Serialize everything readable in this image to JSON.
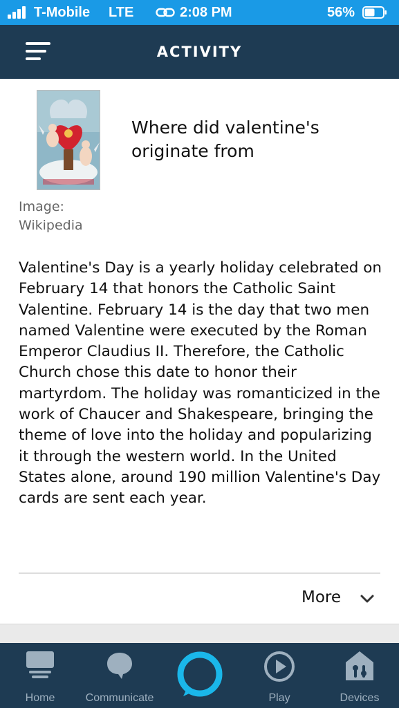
{
  "status_bar": {
    "carrier": "T-Mobile",
    "network": "LTE",
    "time": "2:08 PM",
    "battery": "56%",
    "battery_level": 0.56,
    "icons": [
      "signal-icon",
      "link-icon",
      "battery-icon"
    ]
  },
  "header": {
    "title": "ACTIVITY",
    "menu_icon": "hamburger-menu-icon"
  },
  "card": {
    "question": "Where did valentine's originate from",
    "image_credit": "Image: Wikipedia",
    "answer": "Valentine's Day is a yearly holiday celebrated on February 14 that honors the Catholic Saint Valentine. February 14 is the day that two men named Valentine were executed by the Roman Emperor Claudius II. Therefore, the Catholic Church chose this date to honor their martyrdom. The holiday was romanticized in the work of Chaucer and Shakespeare, bringing the theme of love into the holiday and popularizing it through the western world. In the United States alone, around 190 million Valentine's Day cards are sent each year.",
    "more_label": "More"
  },
  "bottom_nav": {
    "items": [
      {
        "label": "Home",
        "icon": "home-icon"
      },
      {
        "label": "Communicate",
        "icon": "chat-bubble-icon"
      },
      {
        "label": "",
        "icon": "alexa-ring-icon"
      },
      {
        "label": "Play",
        "icon": "play-icon"
      },
      {
        "label": "Devices",
        "icon": "devices-icon"
      }
    ]
  },
  "colors": {
    "status_bar": "#1a9ae6",
    "header": "#1e3b53",
    "nav_inactive": "#9eb0bf",
    "alexa_accent": "#1ab7ea"
  }
}
